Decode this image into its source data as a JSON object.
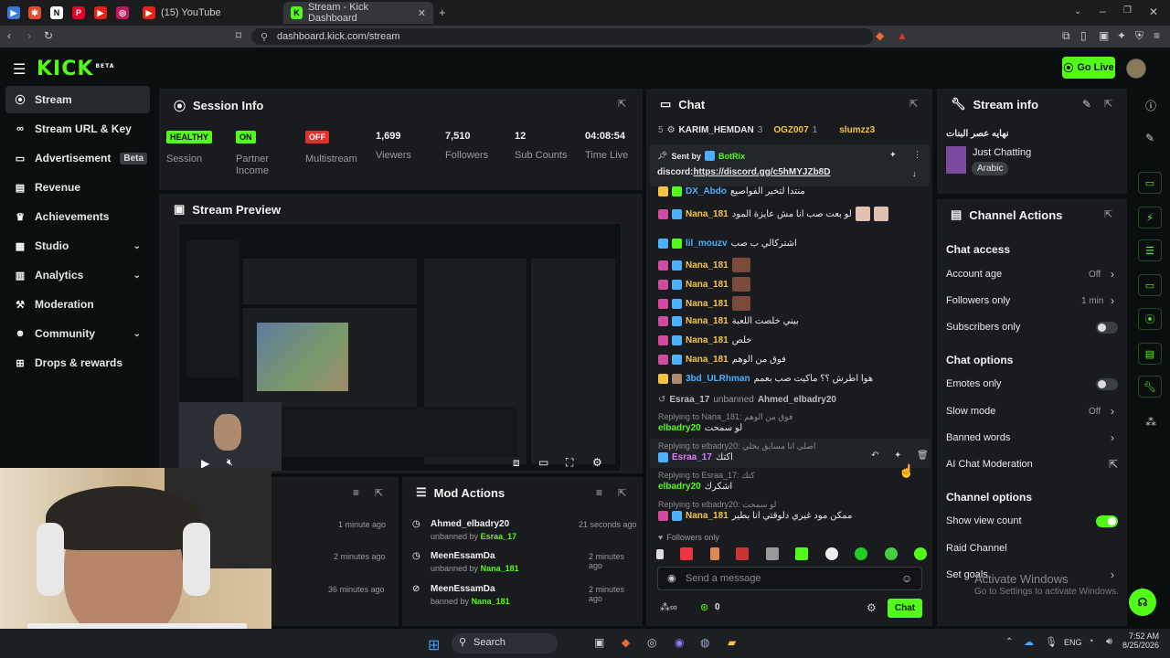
{
  "browser": {
    "tabs": [
      {
        "label": "(15) YouTube"
      },
      {
        "label": "Stream - Kick Dashboard"
      }
    ],
    "url": "dashboard.kick.com/stream"
  },
  "topnav": {
    "logo": "KICK",
    "beta": "BETA",
    "go_live": "Go Live"
  },
  "sidebar": {
    "items": [
      {
        "label": "Stream",
        "icon": "broadcast-icon"
      },
      {
        "label": "Stream URL & Key",
        "icon": "link-icon"
      },
      {
        "label": "Advertisement",
        "icon": "ad-icon",
        "badge": "Beta"
      },
      {
        "label": "Revenue",
        "icon": "revenue-icon"
      },
      {
        "label": "Achievements",
        "icon": "trophy-icon"
      },
      {
        "label": "Studio",
        "icon": "studio-icon"
      },
      {
        "label": "Analytics",
        "icon": "analytics-icon"
      },
      {
        "label": "Moderation",
        "icon": "hammer-icon"
      },
      {
        "label": "Community",
        "icon": "community-icon"
      },
      {
        "label": "Drops & rewards",
        "icon": "gift-icon"
      }
    ]
  },
  "session": {
    "title": "Session Info",
    "stats": [
      {
        "value": "HEALTHY",
        "label": "Session"
      },
      {
        "value": "ON",
        "label": "Partner Income"
      },
      {
        "value": "OFF",
        "label": "Multistream"
      },
      {
        "value": "1,699",
        "label": "Viewers"
      },
      {
        "value": "7,510",
        "label": "Followers"
      },
      {
        "value": "12",
        "label": "Sub Counts"
      },
      {
        "value": "04:08:54",
        "label": "Time Live"
      }
    ]
  },
  "preview": {
    "title": "Stream Preview"
  },
  "left_activity": {
    "times": [
      "1 minute ago",
      "2 minutes ago",
      "36 minutes ago"
    ]
  },
  "mod_actions": {
    "title": "Mod Actions",
    "rows": [
      {
        "user": "Ahmed_elbadry20",
        "action": "unbanned by",
        "by": "Esraa_17",
        "time": "21 seconds ago"
      },
      {
        "user": "MeenEssamDa",
        "action": "unbanned by",
        "by": "Nana_181",
        "time": "2 minutes ago"
      },
      {
        "user": "MeenEssamDa",
        "action": "banned by",
        "by": "Nana_181",
        "time": "2 minutes ago"
      }
    ]
  },
  "chat": {
    "title": "Chat",
    "top": {
      "rank": "5",
      "user1": "KARIM_HEMDAN",
      "n1": "3",
      "user2": "OGZ007",
      "n2": "1",
      "user3": "slumzz3"
    },
    "pinned": {
      "sent_by": "Sent by",
      "bot": "BotRix",
      "text": "discord:",
      "link": "https://discord.gg/c5hMYJZb8D"
    },
    "lines": [
      {
        "user": "DX_Abdo",
        "msg": "منتدا لتخير الفواصيع",
        "color": "b"
      },
      {
        "user": "Nana_181",
        "msg": "لو بعت صب انا مش عايزة المود",
        "color": "y"
      },
      {
        "user": "lil_mouzv",
        "msg": "اشتركالي ب صب",
        "color": "b"
      },
      {
        "user": "Nana_181",
        "msg": "",
        "color": "y"
      },
      {
        "user": "Nana_181",
        "msg": "",
        "color": "y"
      },
      {
        "user": "Nana_181",
        "msg": "",
        "color": "y"
      },
      {
        "user": "Nana_181",
        "msg": "بيني خلصت اللعبة",
        "color": "y"
      },
      {
        "user": "Nana_181",
        "msg": "خلص",
        "color": "y"
      },
      {
        "user": "Nana_181",
        "msg": "فوق من الوهم",
        "color": "y"
      },
      {
        "user": "3bd_ULRhman",
        "msg": "هوا اطرش ؟؟ ماكيت صب بعمم",
        "color": "b"
      }
    ],
    "event": {
      "actor": "Esraa_17",
      "verb": "unbanned",
      "target": "Ahmed_elbadry20"
    },
    "replies": [
      {
        "reply": "Replying to Nana_181: فوق من الوهم",
        "user": "elbadry20",
        "msg": "لو سمحت",
        "color": "g"
      },
      {
        "reply": "Replying to elbadry20: اصلي انا مسابق يخلي",
        "user": "Esraa_17",
        "msg": "اكتك",
        "color": "p"
      },
      {
        "reply": "Replying to Esraa_17: كتك",
        "user": "elbadry20",
        "msg": "اشكرك",
        "color": "g"
      },
      {
        "reply": "Replying to elbadry20: لو سمحت",
        "user": "Nana_181",
        "msg": "ممكن مود غيري دلوقتي انا بطير",
        "color": "y"
      }
    ],
    "followers_only": "Followers only",
    "placeholder": "Send a message",
    "send": "Chat",
    "count": "0"
  },
  "stream_info": {
    "title": "Stream info",
    "stream_title": "نهايه عصر البنات",
    "category": "Just Chatting",
    "tag": "Arabic"
  },
  "channel_actions": {
    "title": "Channel Actions",
    "chat_access": "Chat access",
    "account_age": {
      "label": "Account age",
      "value": "Off"
    },
    "followers_only": {
      "label": "Followers only",
      "value": "1 min"
    },
    "subscribers_only": {
      "label": "Subscribers only"
    },
    "chat_options": "Chat options",
    "emotes_only": {
      "label": "Emotes only"
    },
    "slow_mode": {
      "label": "Slow mode",
      "value": "Off"
    },
    "banned_words": {
      "label": "Banned words"
    },
    "ai_mod": {
      "label": "AI Chat Moderation"
    },
    "channel_options": "Channel options",
    "show_view_count": {
      "label": "Show view count"
    },
    "raid": {
      "label": "Raid Channel"
    },
    "set_goals": {
      "label": "Set goals"
    }
  },
  "watermark": {
    "line1": "Activate Windows",
    "line2": "Go to Settings to activate Windows."
  },
  "taskbar": {
    "search": "Search",
    "lang": "ENG",
    "time": "7:52 AM",
    "date": "8/25/2026"
  },
  "colors": {
    "accent": "#53fc18",
    "panel": "#191b1f",
    "bg": "#0b0e0f"
  }
}
